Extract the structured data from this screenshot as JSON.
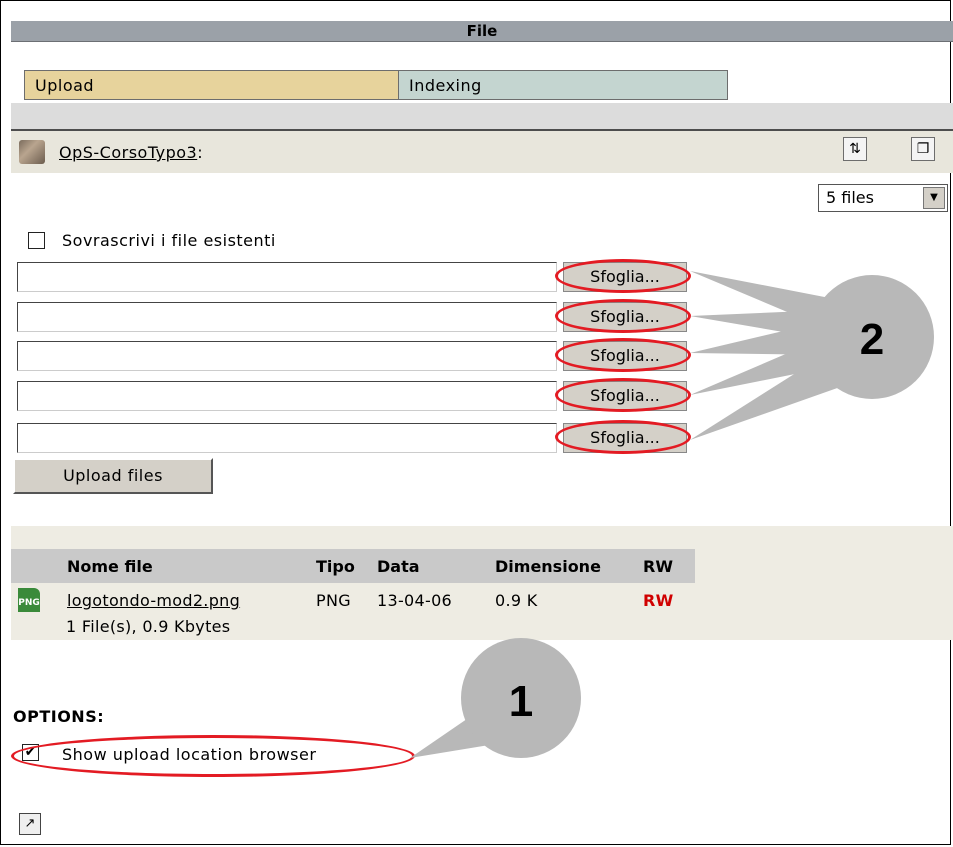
{
  "window": {
    "title": "File"
  },
  "tabs": [
    {
      "label": "Upload",
      "active": true
    },
    {
      "label": "Indexing",
      "active": false
    }
  ],
  "path": {
    "folder": "OpS-CorsoTypo3",
    "suffix": ":"
  },
  "toolbar": {
    "refresh_icon": "refresh-icon",
    "new_window_icon": "new-window-icon"
  },
  "upload": {
    "file_count_select": "5 files",
    "overwrite_label": "Sovrascrivi i file esistenti",
    "overwrite_checked": false,
    "browse_labels": [
      "Sfoglia...",
      "Sfoglia...",
      "Sfoglia...",
      "Sfoglia...",
      "Sfoglia..."
    ],
    "upload_button": "Upload files"
  },
  "file_list": {
    "columns": [
      "Nome file",
      "Tipo",
      "Data",
      "Dimensione",
      "RW"
    ],
    "rows": [
      {
        "icon": "PNG",
        "name": "logotondo-mod2.png",
        "type": "PNG",
        "date": "13-04-06",
        "size": "0.9 K",
        "rw": "RW"
      }
    ],
    "summary": "1 File(s), 0.9 Kbytes"
  },
  "options": {
    "heading": "OPTIONS:",
    "show_location_label": "Show upload location browser",
    "show_location_checked": true
  },
  "annotations": {
    "callout_1": "1",
    "callout_2": "2"
  },
  "colors": {
    "highlight_ring": "#e31b23",
    "rw_text": "#d00000",
    "upload_tab": "#e7d39c",
    "indexing_tab": "#c4d5d0"
  }
}
